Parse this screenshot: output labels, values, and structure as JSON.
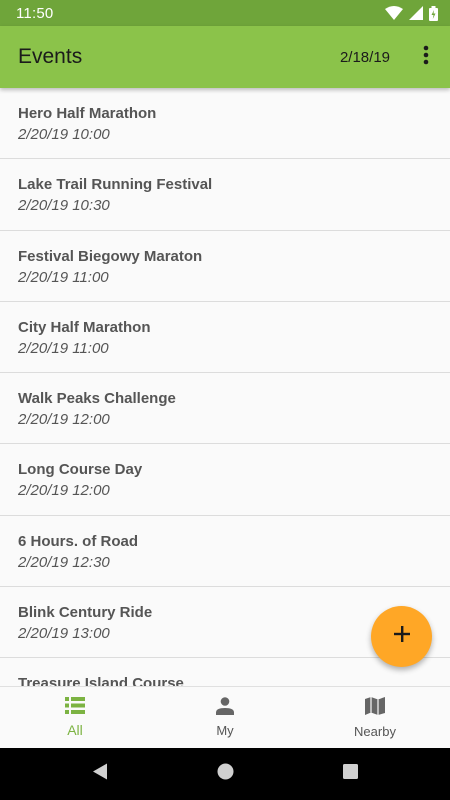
{
  "status_bar": {
    "time": "11:50"
  },
  "app_bar": {
    "title": "Events",
    "date": "2/18/19"
  },
  "events": [
    {
      "name": "Hero Half Marathon",
      "time": "2/20/19 10:00"
    },
    {
      "name": "Lake Trail Running Festival",
      "time": "2/20/19 10:30"
    },
    {
      "name": "Festival Biegowy Maraton",
      "time": "2/20/19 11:00"
    },
    {
      "name": "City Half Marathon",
      "time": "2/20/19 11:00"
    },
    {
      "name": "Walk Peaks Challenge",
      "time": "2/20/19 12:00"
    },
    {
      "name": "Long Course Day",
      "time": "2/20/19 12:00"
    },
    {
      "name": "6 Hours. of Road",
      "time": "2/20/19 12:30"
    },
    {
      "name": "Blink Century Ride",
      "time": "2/20/19 13:00"
    },
    {
      "name": "Treasure Island Course",
      "time": ""
    }
  ],
  "bottom_nav": {
    "active_color": "#7cb342",
    "items": [
      {
        "label": "All",
        "icon": "list-icon",
        "active": true
      },
      {
        "label": "My",
        "icon": "person-icon",
        "active": false
      },
      {
        "label": "Nearby",
        "icon": "map-icon",
        "active": false
      }
    ]
  },
  "fab": {
    "icon": "add-icon",
    "color": "#ffa726"
  },
  "colors": {
    "app_bar": "#8bc34a",
    "status_bar": "#6fa53a"
  }
}
